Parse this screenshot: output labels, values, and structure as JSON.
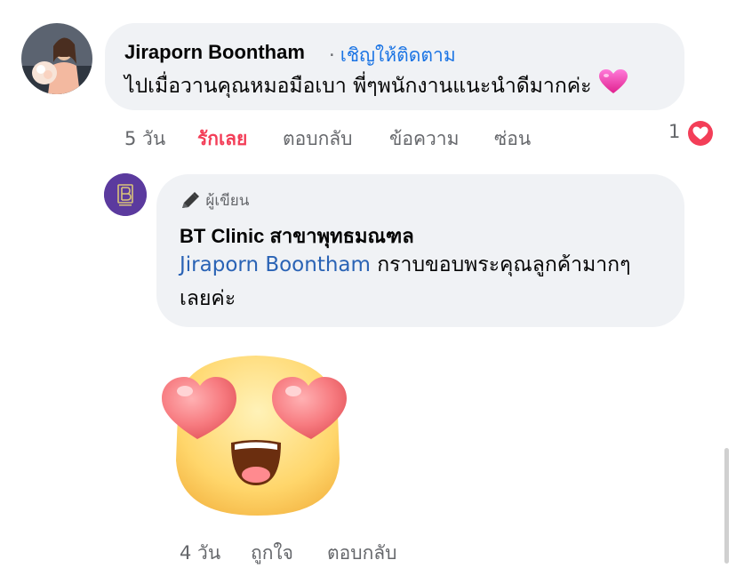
{
  "comment1": {
    "author": "Jiraporn Boontham",
    "separator": "·",
    "follow_label": "เชิญให้ติดตาม",
    "text": "ไปเมื่อวานคุณหมอมือเบา พี่ๆพนักงานแนะนำดีมากค่ะ",
    "emoji": "pink-heart-icon",
    "time": "5 วัน",
    "reaction_label": "รักเลย",
    "reply_label": "ตอบกลับ",
    "message_label": "ข้อความ",
    "hide_label": "ซ่อน",
    "reaction_count": "1",
    "reaction_icon": "love-reaction-icon"
  },
  "reply": {
    "badge_icon": "pen-icon",
    "badge_label": "ผู้เขียน",
    "author": "BT Clinic สาขาพุทธมณฑล",
    "mention": "Jiraporn Boontham",
    "text_line1": " กราบขอบพระคุณลูกค้ามากๆ",
    "text_line2": "เลยค่ะ",
    "sticker": "heart-eyes-emoji-sticker",
    "time": "4 วัน",
    "like_label": "ถูกใจ",
    "reply_label": "ตอบกลับ"
  },
  "colors": {
    "bubble": "#f0f2f5",
    "link": "#1b74e4",
    "love": "#f33e58",
    "meta": "#65676b"
  }
}
